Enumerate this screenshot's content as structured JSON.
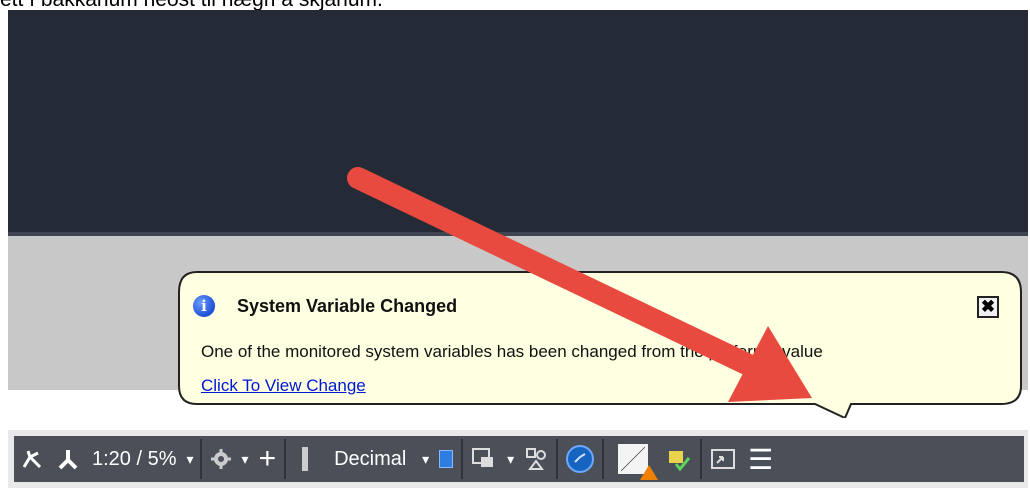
{
  "caption": "ett í bakkanum neðst til hægri á skjánum.",
  "notification": {
    "title": "System Variable Changed",
    "message": "One of the monitored system variables has been changed from the preferred value",
    "link": "Click To View Change",
    "close_label": "✖",
    "info_glyph": "i"
  },
  "statusbar": {
    "scale": "1:20 / 5%",
    "units": "Decimal",
    "caret": "▾",
    "plus": "+",
    "menu": "☰"
  },
  "colors": {
    "canvas": "#252b36",
    "statusbar": "#4a4f58",
    "balloon": "#ffffe1",
    "arrow": "#e84a3f",
    "link": "#0018d6"
  },
  "icons": [
    "annotation-visibility-icon",
    "annotation-scale-icon",
    "gear-icon",
    "crosshair-icon",
    "units-ruler-icon",
    "quick-properties-icon",
    "isolate-objects-icon",
    "workspace-icon",
    "hardware-acceleration-icon",
    "sysvar-monitor-icon",
    "clean-screen-icon",
    "customization-menu-icon"
  ]
}
